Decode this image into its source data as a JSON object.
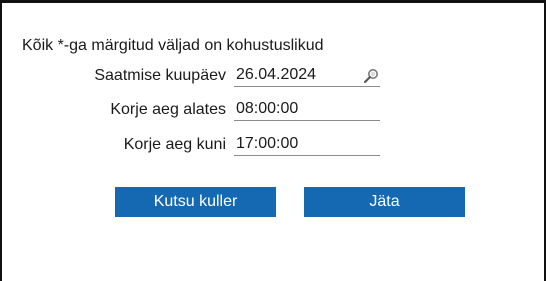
{
  "form": {
    "required_note": "Kõik *-ga märgitud väljad on kohustuslikud",
    "fields": [
      {
        "label": "Saatmise kuupäev",
        "value": "26.04.2024",
        "icon": "search-icon"
      },
      {
        "label": "Korje aeg alates",
        "value": "08:00:00"
      },
      {
        "label": "Korje aeg kuni",
        "value": "17:00:00"
      }
    ]
  },
  "buttons": {
    "call_courier": "Kutsu kuller",
    "cancel": "Jäta"
  },
  "colors": {
    "button_bg": "#1569b2",
    "button_text": "#ffffff",
    "field_underline": "#8c8c8c"
  }
}
